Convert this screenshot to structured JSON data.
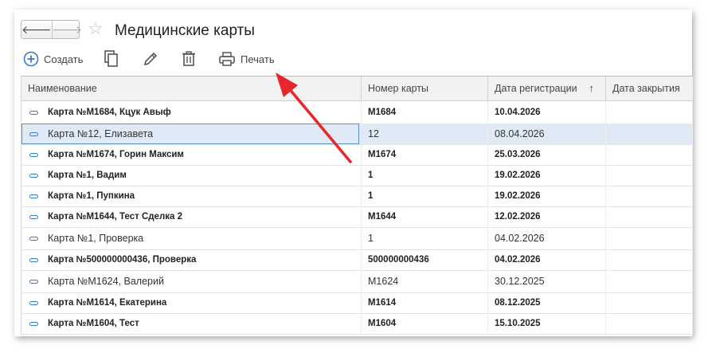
{
  "window": {
    "title": "Медицинские карты"
  },
  "toolbar": {
    "create_label": "Создать",
    "print_label": "Печать"
  },
  "columns": [
    "Наименование",
    "Номер карты",
    "Дата регистрации",
    "Дата закрытия"
  ],
  "sort": {
    "column": "Дата регистрации",
    "direction": "asc",
    "indicator": "↑"
  },
  "rows": [
    {
      "name": "Карта №М1684, Кцук Авыф",
      "number": "М1684",
      "date": "10.04.2026",
      "closed": "",
      "bold": true,
      "selected": false
    },
    {
      "name": "Карта №12, Елизавета",
      "number": "12",
      "date": "08.04.2026",
      "closed": "",
      "bold": false,
      "selected": true
    },
    {
      "name": "Карта №М1674, Горин Максим",
      "number": "М1674",
      "date": "25.03.2026",
      "closed": "",
      "bold": true,
      "selected": false
    },
    {
      "name": "Карта №1, Вадим",
      "number": "1",
      "date": "19.02.2026",
      "closed": "",
      "bold": true,
      "selected": false
    },
    {
      "name": "Карта №1, Пупкина",
      "number": "1",
      "date": "19.02.2026",
      "closed": "",
      "bold": true,
      "selected": false
    },
    {
      "name": "Карта №М1644, Тест Сделка 2",
      "number": "М1644",
      "date": "12.02.2026",
      "closed": "",
      "bold": true,
      "selected": false
    },
    {
      "name": "Карта №1, Проверка",
      "number": "1",
      "date": "04.02.2026",
      "closed": "",
      "bold": false,
      "selected": false
    },
    {
      "name": "Карта №500000000436, Проверка",
      "number": "500000000436",
      "date": "04.02.2026",
      "closed": "",
      "bold": true,
      "selected": false
    },
    {
      "name": "Карта №М1624, Валерий",
      "number": "М1624",
      "date": "30.12.2025",
      "closed": "",
      "bold": false,
      "selected": false
    },
    {
      "name": "Карта №М1614, Екатерина",
      "number": "М1614",
      "date": "08.12.2025",
      "closed": "",
      "bold": true,
      "selected": false
    },
    {
      "name": "Карта №М1604, Тест",
      "number": "М1604",
      "date": "15.10.2025",
      "closed": "",
      "bold": true,
      "selected": false
    }
  ],
  "colors": {
    "accent": "#3c7cc4",
    "arrow": "#e8262c",
    "selection": "#dfeaf6"
  }
}
